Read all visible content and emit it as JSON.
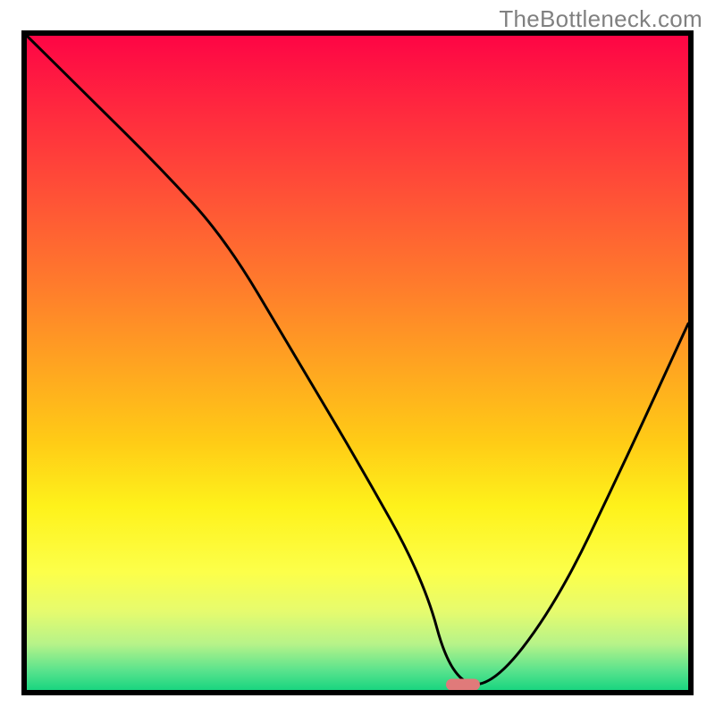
{
  "watermark": "TheBottleneck.com",
  "chart_data": {
    "type": "line",
    "title": "",
    "xlabel": "",
    "ylabel": "",
    "xlim": [
      0,
      100
    ],
    "ylim": [
      0,
      100
    ],
    "x": [
      0,
      10,
      20,
      30,
      40,
      50,
      60,
      64,
      70,
      80,
      90,
      100
    ],
    "values": [
      100,
      90,
      80,
      69,
      52,
      35,
      17,
      2,
      0,
      13,
      34,
      56
    ],
    "optimal_x": 66,
    "optimal_y": 0,
    "background_gradient": {
      "stops": [
        {
          "pos": 0.0,
          "color": "#fe0545"
        },
        {
          "pos": 0.12,
          "color": "#ff2b3e"
        },
        {
          "pos": 0.25,
          "color": "#ff5336"
        },
        {
          "pos": 0.38,
          "color": "#ff7b2c"
        },
        {
          "pos": 0.5,
          "color": "#ffa321"
        },
        {
          "pos": 0.62,
          "color": "#ffcb16"
        },
        {
          "pos": 0.72,
          "color": "#fef21b"
        },
        {
          "pos": 0.82,
          "color": "#fcff4a"
        },
        {
          "pos": 0.88,
          "color": "#e6fb6e"
        },
        {
          "pos": 0.93,
          "color": "#b6f389"
        },
        {
          "pos": 0.97,
          "color": "#5ae38d"
        },
        {
          "pos": 1.0,
          "color": "#19d580"
        }
      ]
    }
  },
  "colors": {
    "curve": "#000000",
    "marker": "#e07a7a",
    "border": "#000000"
  }
}
